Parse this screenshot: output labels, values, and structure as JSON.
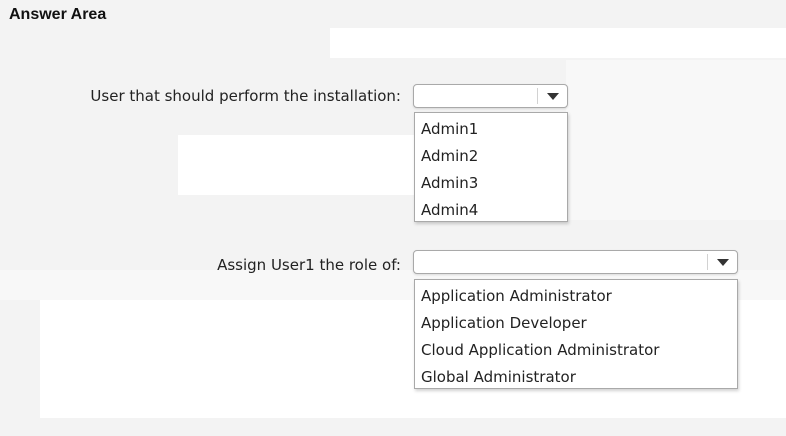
{
  "answer_area": {
    "title": "Answer Area"
  },
  "questions": [
    {
      "label": "User that should perform the installation:",
      "selected": "",
      "options": [
        "Admin1",
        "Admin2",
        "Admin3",
        "Admin4"
      ]
    },
    {
      "label": "Assign User1 the role of:",
      "selected": "",
      "options": [
        "Application Administrator",
        "Application Developer",
        "Cloud Application Administrator",
        "Global Administrator"
      ]
    }
  ],
  "icons": {
    "dropdown": "chevron-down-icon"
  }
}
